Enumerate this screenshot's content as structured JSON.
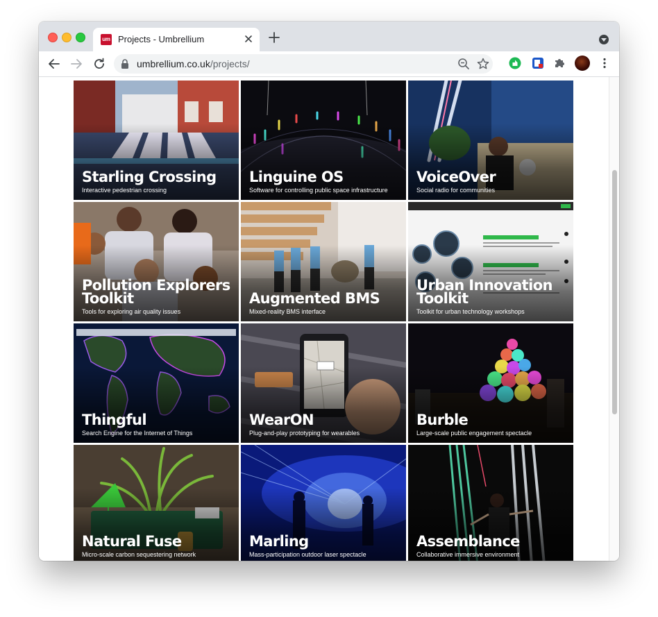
{
  "browser": {
    "tab": {
      "title": "Projects - Umbrellium",
      "favicon_text": "um",
      "favicon_color": "#c8102e"
    },
    "address": {
      "host": "umbrellium.co.uk",
      "path": "/projects/"
    },
    "icons": [
      "back-arrow-icon",
      "forward-arrow-icon",
      "reload-icon",
      "lock-icon",
      "zoom-out-icon",
      "bookmark-star-icon",
      "extension-green-icon",
      "extension-blue-icon",
      "puzzle-icon",
      "profile-avatar",
      "more-menu-icon",
      "tab-search-icon"
    ]
  },
  "projects": [
    {
      "title": "Starling Crossing",
      "subtitle": "Interactive pedestrian crossing",
      "palette": [
        "#9aa6b4",
        "#4b5a78",
        "#2b3a5a"
      ]
    },
    {
      "title": "Linguine OS",
      "subtitle": "Software for controlling public space infrastructure",
      "palette": [
        "#0b0b10",
        "#2a2a3a",
        "#6a5acd"
      ]
    },
    {
      "title": "VoiceOver",
      "subtitle": "Social radio for communities",
      "palette": [
        "#1e3c6e",
        "#2c4f8a",
        "#0f1d35"
      ]
    },
    {
      "title": "Pollution Explorers Toolkit",
      "subtitle": "Tools for exploring air quality issues",
      "palette": [
        "#8a7a6e",
        "#c9c4c6",
        "#3a3030"
      ]
    },
    {
      "title": "Augmented BMS",
      "subtitle": "Mixed-reality BMS interface",
      "palette": [
        "#c9b8a6",
        "#e8e2dc",
        "#7a6a5a"
      ]
    },
    {
      "title": "Urban Innovation Toolkit",
      "subtitle": "Toolkit for urban technology workshops",
      "palette": [
        "#f2f2f2",
        "#3d5a7a",
        "#2fb84a"
      ]
    },
    {
      "title": "Thingful",
      "subtitle": "Search Engine for the Internet of Things",
      "palette": [
        "#0a1a3a",
        "#2b4a8a",
        "#8a4ac8"
      ]
    },
    {
      "title": "WearON",
      "subtitle": "Plug-and-play prototyping for wearables",
      "palette": [
        "#4a4852",
        "#2a2830",
        "#8a8690"
      ]
    },
    {
      "title": "Burble",
      "subtitle": "Large-scale public engagement spectacle",
      "palette": [
        "#0a0a10",
        "#3a2a1a",
        "#e84aa8"
      ]
    },
    {
      "title": "Natural Fuse",
      "subtitle": "Micro-scale carbon sequestering network",
      "palette": [
        "#5a4a3a",
        "#1f5a3a",
        "#7ab83a"
      ]
    },
    {
      "title": "Marling",
      "subtitle": "Mass-participation outdoor laser spectacle",
      "palette": [
        "#0a1e8a",
        "#3a6ae8",
        "#061050"
      ]
    },
    {
      "title": "Assemblance",
      "subtitle": "Collaborative immersive environment",
      "palette": [
        "#0a0a0a",
        "#2a3a3a",
        "#5ae8b8"
      ]
    }
  ]
}
